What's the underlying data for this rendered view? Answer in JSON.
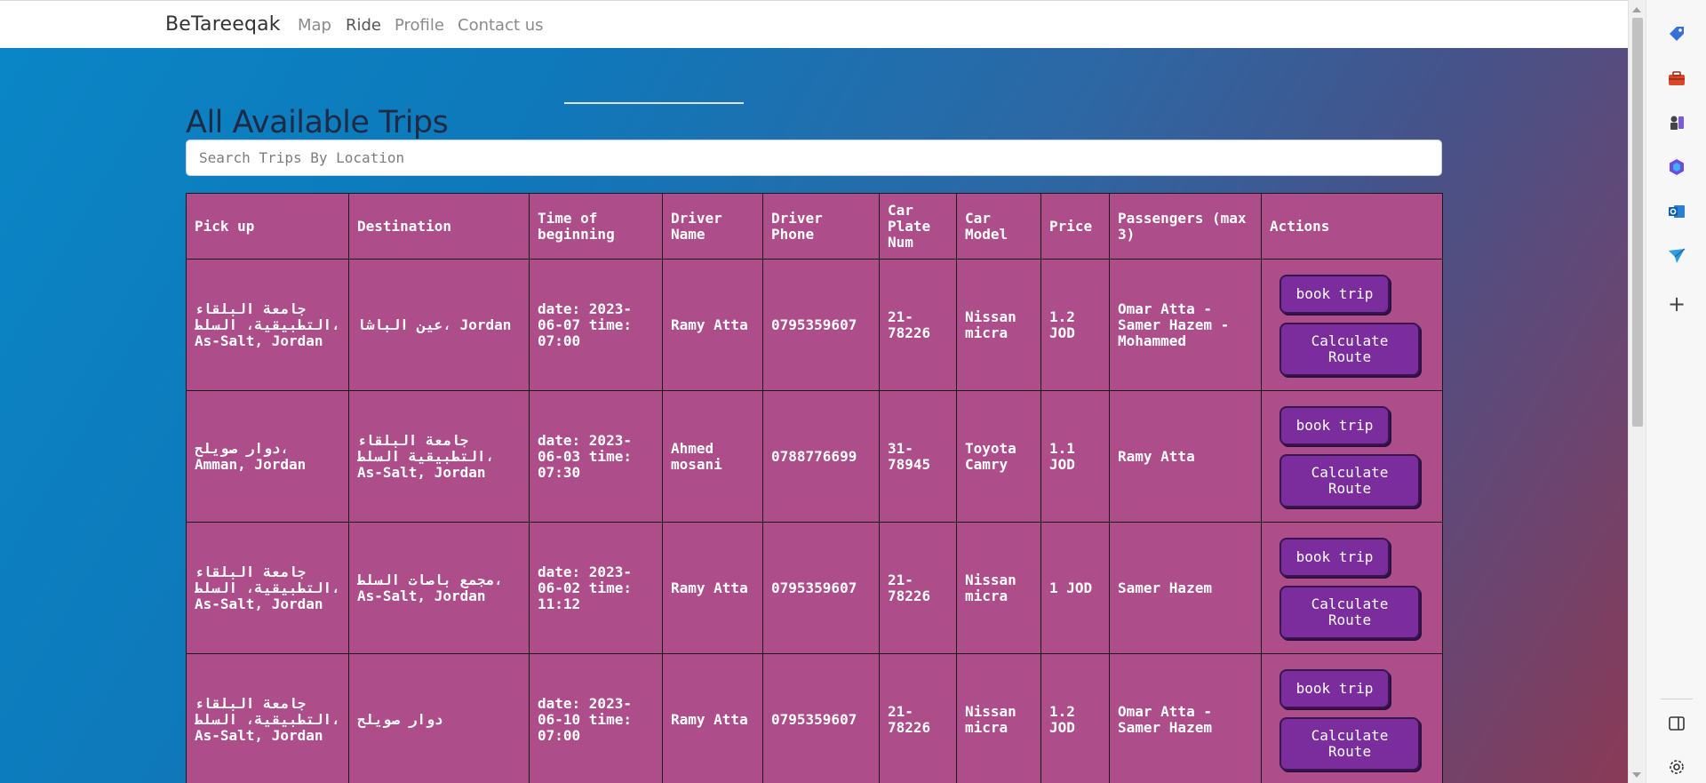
{
  "navbar": {
    "brand": "BeTareeqak",
    "links": [
      "Map",
      "Ride",
      "Profile",
      "Contact us"
    ],
    "active": "Ride"
  },
  "main": {
    "title": "All Available Trips",
    "search_placeholder": "Search Trips By Location"
  },
  "table": {
    "headers": [
      "Pick up",
      "Destination",
      "Time of beginning",
      "Driver Name",
      "Driver Phone",
      "Car Plate Num",
      "Car Model",
      "Price",
      "Passengers (max 3)",
      "Actions"
    ],
    "rows": [
      {
        "pickup": "جامعة البلقاء التطبيقية، السلط، As-Salt, Jordan",
        "destination": "عين الباشا، Jordan",
        "time": "date: 2023-06-07 time: 07:00",
        "driver_name": "Ramy Atta",
        "driver_phone": "0795359607",
        "plate": "21-78226",
        "model": "Nissan micra",
        "price": "1.2 JOD",
        "passengers": "Omar Atta - Samer Hazem - Mohammed"
      },
      {
        "pickup": "دوار صويلح، Amman, Jordan",
        "destination": "جامعة البلقاء التطبيقية السلط، As-Salt, Jordan",
        "time": "date: 2023-06-03 time: 07:30",
        "driver_name": "Ahmed mosani",
        "driver_phone": "0788776699",
        "plate": "31-78945",
        "model": "Toyota Camry",
        "price": "1.1 JOD",
        "passengers": "Ramy Atta"
      },
      {
        "pickup": "جامعة البلقاء التطبيقية، السلط، As-Salt, Jordan",
        "destination": "مجمع باصات السلط، As-Salt, Jordan",
        "time": "date: 2023-06-02 time: 11:12",
        "driver_name": "Ramy Atta",
        "driver_phone": "0795359607",
        "plate": "21-78226",
        "model": "Nissan micra",
        "price": "1 JOD",
        "passengers": "Samer Hazem"
      },
      {
        "pickup": "جامعة البلقاء التطبيقية، السلط، As-Salt, Jordan",
        "destination": "دوار صويلح",
        "time": "date: 2023-06-10 time: 07:00",
        "driver_name": "Ramy Atta",
        "driver_phone": "0795359607",
        "plate": "21-78226",
        "model": "Nissan micra",
        "price": "1.2 JOD",
        "passengers": "Omar Atta - Samer Hazem"
      }
    ],
    "actions": {
      "book_label": "book trip",
      "route_label": "Calculate Route"
    }
  },
  "browser_sidebar": {
    "icons": [
      "tag-icon",
      "toolbox-icon",
      "chess-icon",
      "copilot-icon",
      "outlook-icon",
      "send-icon",
      "plus-icon",
      "split-screen-icon",
      "settings-icon"
    ]
  },
  "colors": {
    "table_bg": "#ad4d8a",
    "button_bg": "#7b2d9e",
    "gradient_start": "#0a86c6",
    "gradient_end": "#8a3a56"
  }
}
